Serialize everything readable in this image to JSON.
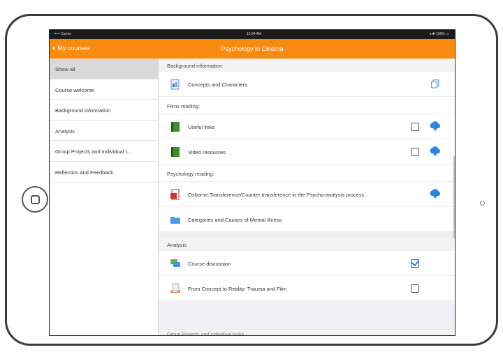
{
  "statusbar": {
    "carrier": "••••• Carrier ",
    "time": "10:34 AM",
    "battery": "◂ ✱ 100% ▭"
  },
  "navbar": {
    "back_label": "My courses",
    "title": "Psychology in Cinema"
  },
  "sidebar": {
    "items": [
      {
        "label": "Show all",
        "active": true
      },
      {
        "label": "Course welcome"
      },
      {
        "label": "Background information"
      },
      {
        "label": "Analysis"
      },
      {
        "label": "Group Projects and Individual t..."
      },
      {
        "label": "Reflection and Feedback"
      }
    ]
  },
  "content": {
    "background": {
      "header": "Background information",
      "concepts": "Concepts and Characters",
      "films_reading": "Films reading:",
      "useful_links": "Useful links",
      "video_resources": "Video resources",
      "psychology_reading": "Psychology reading:",
      "osborne": "Osborne:Transference/Counter transference in the Psycho-analysis process",
      "categories": "Categories and Causes of Mental illness"
    },
    "analysis": {
      "header": "Analysis",
      "discussion": "Course discussion",
      "concept_reality": "From Concept to Reality: Trauma and Film"
    },
    "next_header": "Group Projects and Individual tasks"
  },
  "colors": {
    "accent": "#f98b10",
    "cloud": "#2f86d8"
  }
}
